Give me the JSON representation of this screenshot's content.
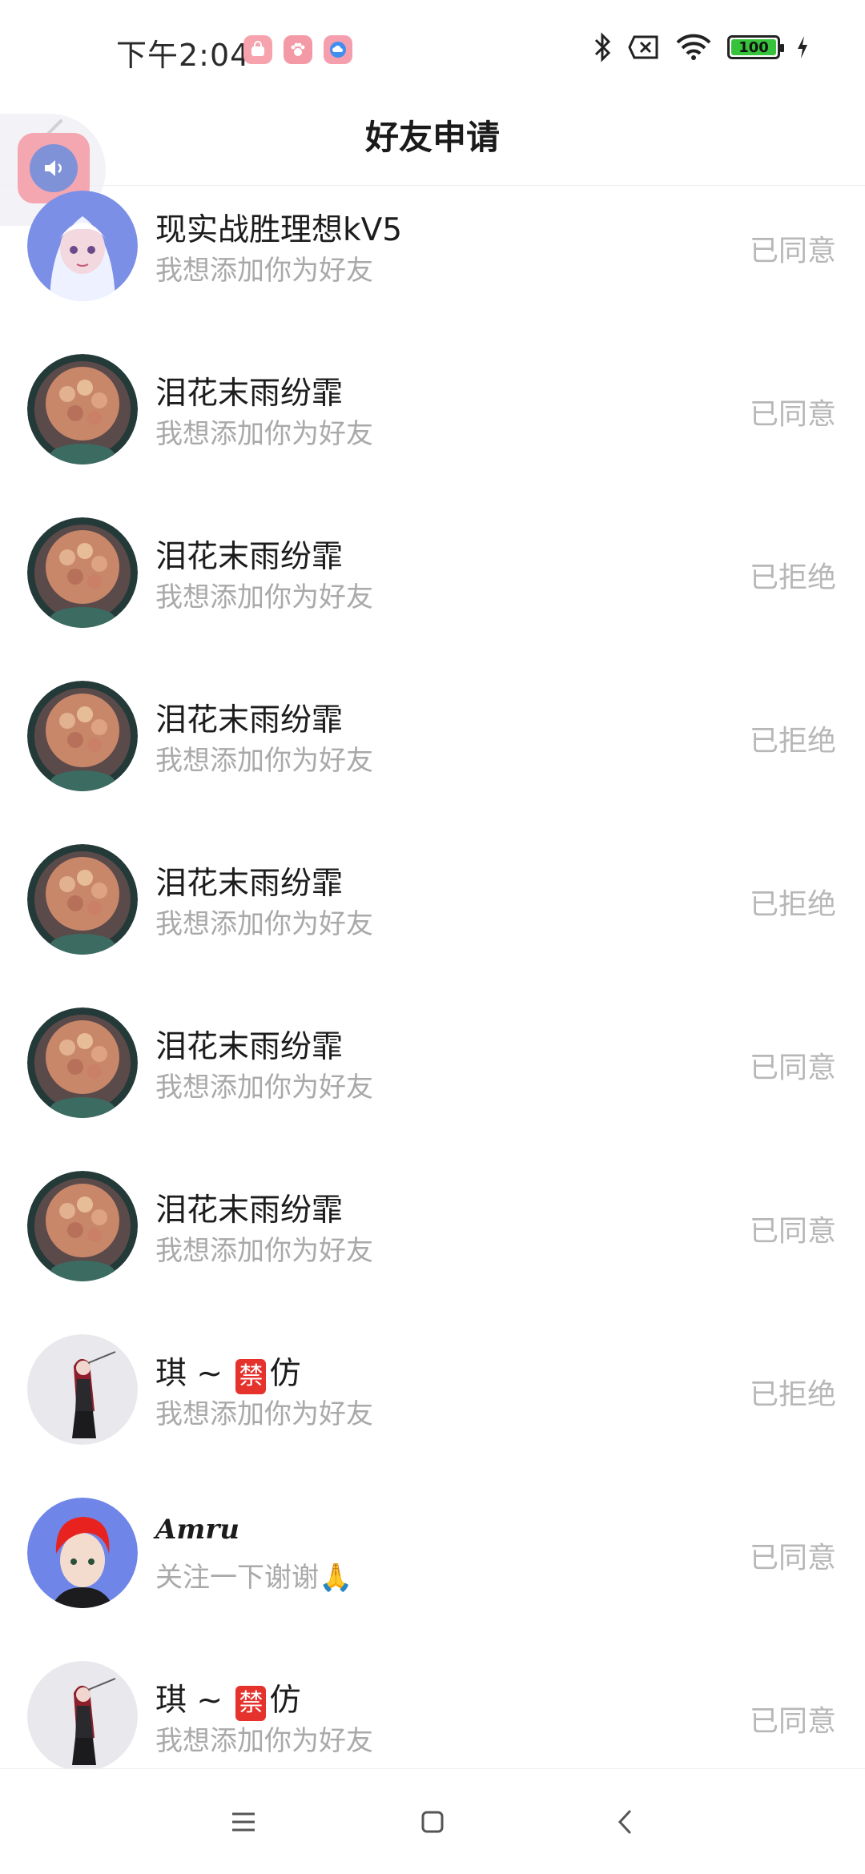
{
  "status_bar": {
    "time": "下午2:04",
    "battery": "100",
    "apps": [
      "pink-bag-app",
      "paw-app",
      "cloud-app"
    ],
    "icons": [
      "bluetooth-icon",
      "no-sim-icon",
      "wifi-icon",
      "battery-icon",
      "charging-icon"
    ]
  },
  "header": {
    "title": "好友申请",
    "back_icon": "chevron-left-icon"
  },
  "colors": {
    "status_text": "#b7b7b7",
    "message_text": "#a9a9a9",
    "ban_badge": "#e5322d"
  },
  "requests": [
    {
      "name": "现实战胜理想kV5",
      "message": "我想添加你为好友",
      "status": "已同意",
      "avatar": "white-hair-anime-avatar"
    },
    {
      "name": "泪花末雨纷霏",
      "message": "我想添加你为好友",
      "status": "已同意",
      "avatar": "curly-hair-avatar"
    },
    {
      "name": "泪花末雨纷霏",
      "message": "我想添加你为好友",
      "status": "已拒绝",
      "avatar": "curly-hair-avatar"
    },
    {
      "name": "泪花末雨纷霏",
      "message": "我想添加你为好友",
      "status": "已拒绝",
      "avatar": "curly-hair-avatar"
    },
    {
      "name": "泪花末雨纷霏",
      "message": "我想添加你为好友",
      "status": "已拒绝",
      "avatar": "curly-hair-avatar"
    },
    {
      "name": "泪花末雨纷霏",
      "message": "我想添加你为好友",
      "status": "已同意",
      "avatar": "curly-hair-avatar"
    },
    {
      "name": "泪花末雨纷霏",
      "message": "我想添加你为好友",
      "status": "已同意",
      "avatar": "curly-hair-avatar"
    },
    {
      "name_prefix": "琪 ~ ",
      "name_badge": "禁",
      "name_suffix": "仿",
      "message": "我想添加你为好友",
      "status": "已拒绝",
      "avatar": "red-hair-girl-avatar"
    },
    {
      "name": "Amru",
      "message": "关注一下谢谢🙏",
      "status": "已同意",
      "avatar": "red-hair-boy-avatar"
    },
    {
      "name_prefix": "琪 ~ ",
      "name_badge": "禁",
      "name_suffix": "仿",
      "message": "我想添加你为好友",
      "status": "已同意",
      "avatar": "red-hair-girl-avatar"
    }
  ],
  "bottom_nav": [
    "menu-icon",
    "home-square-icon",
    "back-triangle-icon"
  ]
}
